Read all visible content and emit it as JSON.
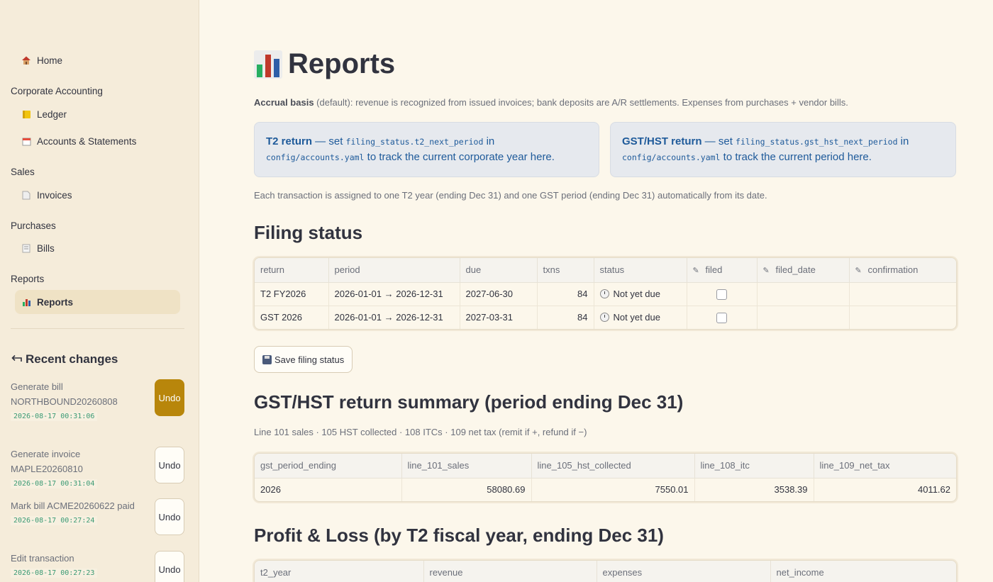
{
  "sidebar": {
    "home": "Home",
    "sections": [
      {
        "title": "Corporate Accounting",
        "items": [
          "Ledger",
          "Accounts & Statements"
        ]
      },
      {
        "title": "Sales",
        "items": [
          "Invoices"
        ]
      },
      {
        "title": "Purchases",
        "items": [
          "Bills"
        ]
      },
      {
        "title": "Reports",
        "items": [
          "Reports"
        ]
      }
    ],
    "active_item": "Reports",
    "recent_title": "Recent changes",
    "recent": [
      {
        "label": "Generate bill NORTHBOUND20260808",
        "time": "2026-08-17 00:31:06",
        "button": "Undo"
      },
      {
        "label": "Generate invoice MAPLE20260810",
        "time": "2026-08-17 00:31:04",
        "button": "Undo"
      },
      {
        "label": "Mark bill ACME20260622 paid",
        "time": "2026-08-17 00:27:24",
        "button": "Undo"
      },
      {
        "label": "Edit transaction",
        "time": "2026-08-17 00:27:23",
        "button": "Undo"
      }
    ]
  },
  "main": {
    "title": "Reports",
    "basis_strong": "Accrual basis",
    "basis_rest": " (default): revenue is recognized from issued invoices; bank deposits are A/R settlements. Expenses from purchases + vendor bills.",
    "t2_box": {
      "strong": "T2 return",
      "pre": " — set ",
      "code1": "filing_status.t2_next_period",
      "mid": " in ",
      "code2": "config/accounts.yaml",
      "post": " to track the current corporate year here."
    },
    "gst_box": {
      "strong": "GST/HST return",
      "pre": " — set ",
      "code1": "filing_status.gst_hst_next_period",
      "mid": " in ",
      "code2": "config/accounts.yaml",
      "post": " to track the current period here."
    },
    "assign_note": "Each transaction is assigned to one T2 year (ending Dec 31) and one GST period (ending Dec 31) automatically from its date.",
    "filing_title": "Filing status",
    "filing_columns": [
      "return",
      "period",
      "due",
      "txns",
      "status",
      "filed",
      "filed_date",
      "confirmation"
    ],
    "filing_rows": [
      {
        "return": "T2 FY2026",
        "period": "2026-01-01 → 2026-12-31",
        "due": "2027-06-30",
        "txns": "84",
        "status": "Not yet due",
        "filed": false,
        "filed_date": "",
        "confirmation": ""
      },
      {
        "return": "GST 2026",
        "period": "2026-01-01 → 2026-12-31",
        "due": "2027-03-31",
        "txns": "84",
        "status": "Not yet due",
        "filed": false,
        "filed_date": "",
        "confirmation": ""
      }
    ],
    "save_label": "Save filing status",
    "gst_title": "GST/HST return summary (period ending Dec 31)",
    "gst_caption": "Line 101 sales · 105 HST collected · 108 ITCs · 109 net tax (remit if +, refund if −)",
    "gst_columns": [
      "gst_period_ending",
      "line_101_sales",
      "line_105_hst_collected",
      "line_108_itc",
      "line_109_net_tax"
    ],
    "gst_rows": [
      [
        "2026",
        "58080.69",
        "7550.01",
        "3538.39",
        "4011.62"
      ]
    ],
    "pl_title": "Profit & Loss (by T2 fiscal year, ending Dec 31)",
    "pl_columns": [
      "t2_year",
      "revenue",
      "expenses",
      "net_income"
    ]
  },
  "colors": {
    "accent": "#b8860b",
    "info_text": "#1e5a9a",
    "active_nav": "#efe2c5"
  },
  "icons": {
    "home": "house-icon",
    "ledger": "ledger-icon",
    "accounts": "calendar-icon",
    "invoices": "page-icon",
    "bills": "receipt-icon",
    "reports": "bar-chart-icon",
    "recent": "undo-arrow-icon"
  }
}
